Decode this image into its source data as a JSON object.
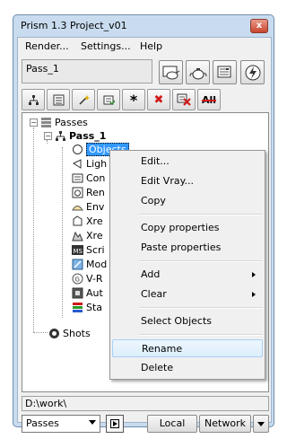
{
  "window": {
    "title": "Prism 1.3   Project_v01",
    "close_glyph": "x"
  },
  "menubar": [
    "Render...",
    "Settings...",
    "Help"
  ],
  "pass_name": "Pass_1",
  "big_toolbar_icons": [
    "render-view-icon",
    "teapot-icon",
    "render-settings-icon",
    "lightning-icon"
  ],
  "toolbar_icons": [
    "hierarchy-icon",
    "pass-icon",
    "wand-icon",
    "list-check-icon",
    "asterisk-icon",
    "delete-x-icon",
    "delete-selected-icon",
    "delete-all-icon"
  ],
  "toolbar_text": {
    "asterisk": "*",
    "x": "✖",
    "all": "All"
  },
  "tree": {
    "passes_label": "Passes",
    "pass_label": "Pass_1",
    "children": [
      "Objects",
      "Ligh",
      "Con",
      "Ren",
      "Env",
      "Xre",
      "Xre",
      "Scri",
      "Mod",
      "V-R",
      "Aut",
      "Sta"
    ],
    "shots_label": "Shots"
  },
  "path": "D:\\work\\",
  "bottom": {
    "combo_value": "Passes",
    "local_label": "Local",
    "network_label": "Network"
  },
  "context_menu": {
    "items": [
      "Edit...",
      "Edit Vray...",
      "Copy",
      "Copy properties",
      "Paste properties",
      "Add",
      "Clear",
      "Select Objects",
      "Rename",
      "Delete"
    ]
  },
  "colors": {
    "window_frame": "#c9dcef",
    "selection": "#3399ff",
    "delete_red": "#d11a1a"
  }
}
